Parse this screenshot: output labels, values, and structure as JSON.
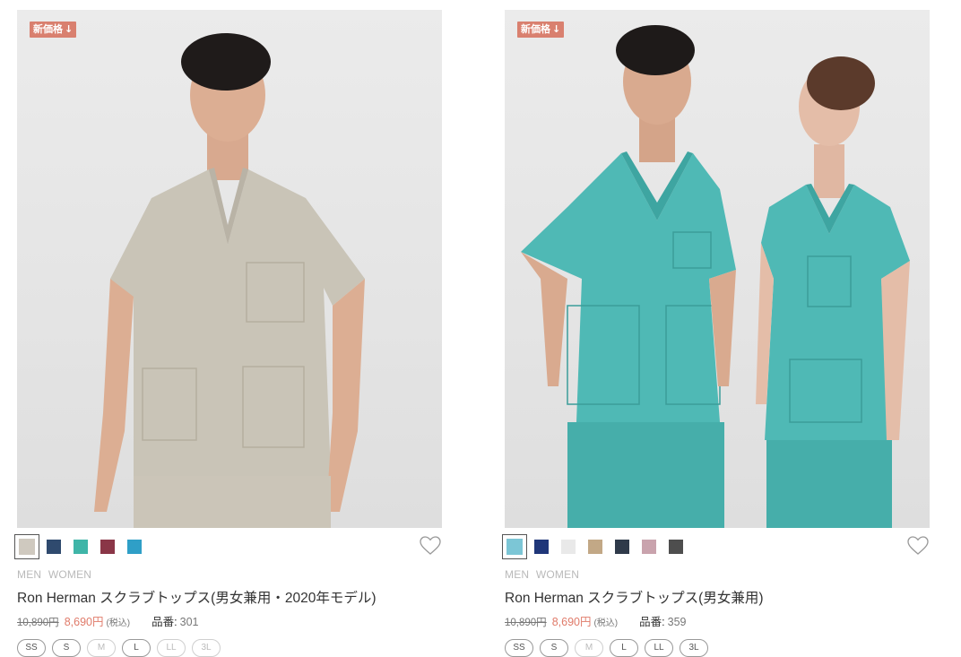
{
  "products": [
    {
      "badge": "新価格",
      "colors": [
        "#cfc9bf",
        "#2f4a6e",
        "#3fb5a8",
        "#8a3647",
        "#2f9fc7"
      ],
      "genders": [
        "MEN",
        "WOMEN"
      ],
      "title": "Ron Herman スクラブトップス(男女兼用・2020年モデル)",
      "old_price": "10,890円",
      "new_price": "8,690円",
      "tax_note": "(税込)",
      "code_label": "品番:",
      "code": "301",
      "sizes": [
        "SS",
        "S",
        "M",
        "L",
        "LL",
        "3L"
      ]
    },
    {
      "badge": "新価格",
      "colors": [
        "#7cc6d6",
        "#1f3679",
        "#e9e9e9",
        "#c2a886",
        "#2f3a4a",
        "#c9a3ad",
        "#4e4e4e"
      ],
      "genders": [
        "MEN",
        "WOMEN"
      ],
      "title": "Ron Herman スクラブトップス(男女兼用)",
      "old_price": "10,890円",
      "new_price": "8,690円",
      "tax_note": "(税込)",
      "code_label": "品番:",
      "code": "359",
      "sizes": [
        "SS",
        "S",
        "M",
        "L",
        "LL",
        "3L"
      ]
    }
  ]
}
